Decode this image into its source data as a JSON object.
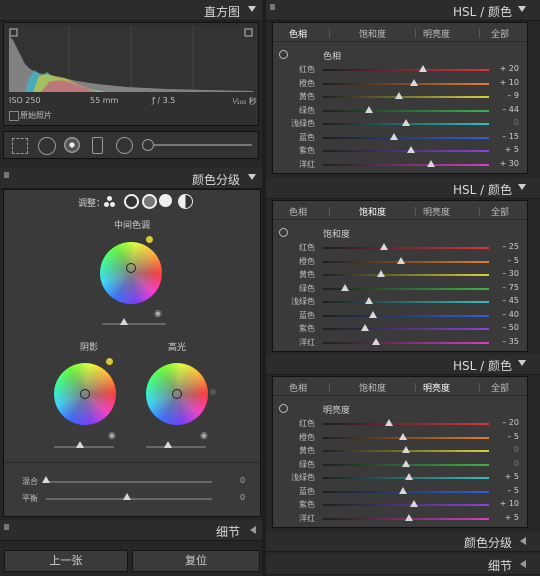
{
  "left": {
    "histogram": {
      "title": "直方图",
      "iso": "ISO 250",
      "focal": "55 mm",
      "aperture": "ƒ / 3.5",
      "shutter": "¹⁄₁₀₀ 秒",
      "original_label": "原始照片"
    },
    "tools_bar": {},
    "split_toning": {
      "title": "颜色分级",
      "adjust_label": "调整：",
      "midtones_label": "中间色调",
      "shadows_label": "阴影",
      "highlights_label": "高光",
      "blending_label": "混合",
      "blending_value": "0",
      "balance_label": "平衡",
      "balance_value": "0"
    },
    "detail_title": "细节",
    "prev_button": "上一张",
    "reset_button": "复位"
  },
  "right": {
    "panels": [
      {
        "title": "HSL / 颜色",
        "tabs": [
          "色相",
          "饱和度",
          "明亮度",
          "全部"
        ],
        "active_tab": 0,
        "section_label": "色相",
        "rows": [
          {
            "label": "红色",
            "value": "+ 20",
            "level": 0.6
          },
          {
            "label": "橙色",
            "value": "+ 10",
            "level": 0.55
          },
          {
            "label": "黄色",
            "value": "– 9",
            "level": 0.46
          },
          {
            "label": "绿色",
            "value": "– 44",
            "level": 0.28
          },
          {
            "label": "浅绿色",
            "value": "0",
            "level": 0.5
          },
          {
            "label": "蓝色",
            "value": "– 15",
            "level": 0.43
          },
          {
            "label": "紫色",
            "value": "+ 5",
            "level": 0.53
          },
          {
            "label": "洋红",
            "value": "+ 30",
            "level": 0.65
          }
        ]
      },
      {
        "title": "HSL / 颜色",
        "tabs": [
          "色相",
          "饱和度",
          "明亮度",
          "全部"
        ],
        "active_tab": 1,
        "section_label": "饱和度",
        "rows": [
          {
            "label": "红色",
            "value": "– 25",
            "level": 0.37
          },
          {
            "label": "橙色",
            "value": "– 5",
            "level": 0.47
          },
          {
            "label": "黄色",
            "value": "– 30",
            "level": 0.35
          },
          {
            "label": "绿色",
            "value": "– 75",
            "level": 0.13
          },
          {
            "label": "浅绿色",
            "value": "– 45",
            "level": 0.28
          },
          {
            "label": "蓝色",
            "value": "– 40",
            "level": 0.3
          },
          {
            "label": "紫色",
            "value": "– 50",
            "level": 0.25
          },
          {
            "label": "洋红",
            "value": "– 35",
            "level": 0.32
          }
        ]
      },
      {
        "title": "HSL / 颜色",
        "tabs": [
          "色相",
          "饱和度",
          "明亮度",
          "全部"
        ],
        "active_tab": 2,
        "section_label": "明亮度",
        "rows": [
          {
            "label": "红色",
            "value": "– 20",
            "level": 0.4
          },
          {
            "label": "橙色",
            "value": "– 5",
            "level": 0.48
          },
          {
            "label": "黄色",
            "value": "0",
            "level": 0.5
          },
          {
            "label": "绿色",
            "value": "0",
            "level": 0.5
          },
          {
            "label": "浅绿色",
            "value": "+ 5",
            "level": 0.52
          },
          {
            "label": "蓝色",
            "value": "– 5",
            "level": 0.48
          },
          {
            "label": "紫色",
            "value": "+ 10",
            "level": 0.55
          },
          {
            "label": "洋红",
            "value": "+ 5",
            "level": 0.52
          }
        ]
      }
    ],
    "color_grading_title": "颜色分级",
    "detail_title": "细节"
  },
  "colors": {
    "red": "#e0313b",
    "orange": "#e87a2c",
    "yellow": "#d9d03a",
    "green": "#39b54a",
    "aqua": "#2bc2c4",
    "blue": "#2f5fe0",
    "purple": "#8a43d8",
    "magenta": "#d63fc3"
  }
}
